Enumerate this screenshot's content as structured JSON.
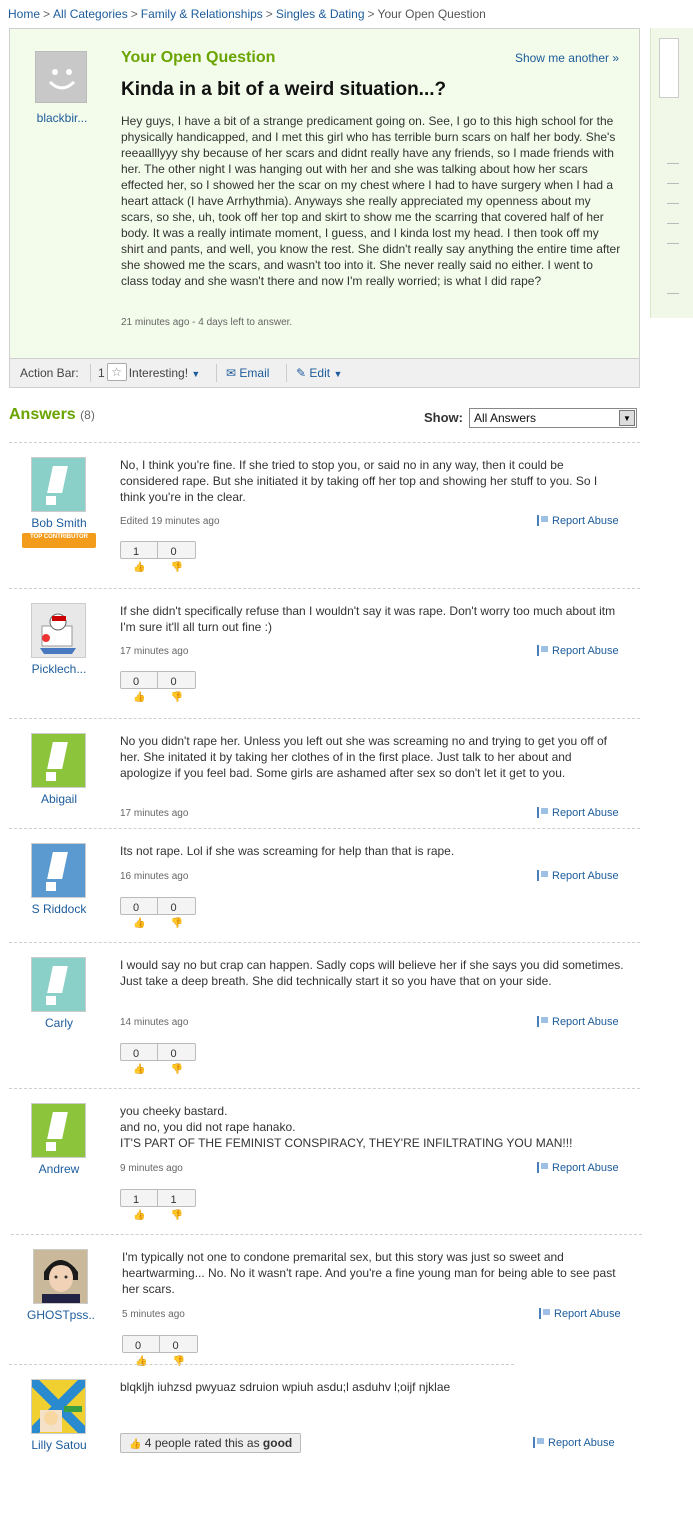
{
  "breadcrumb": {
    "items": [
      "Home",
      "All Categories",
      "Family & Relationships",
      "Singles & Dating"
    ],
    "current": "Your Open Question",
    "separator": ">"
  },
  "question": {
    "asker": "blackbir...",
    "heading": "Your Open Question",
    "show_another": "Show me another »",
    "title": "Kinda in a bit of a weird situation...?",
    "body": "Hey guys, I have a bit of a strange predicament going on. See, I go to this high school for the physically handicapped, and I met this girl who has terrible burn scars on half her body. She's reeaalllyyy shy because of her scars and didnt really have any friends, so I made friends with her. The other night I was hanging out with her and she was talking about how her scars effected her, so I showed her the scar on my chest where I had to have surgery when I had a heart attack (I have Arrhythmia). Anyways she really appreciated my openness about my scars, so she, uh, took off her top and skirt to show me the scarring that covered half of her body. It was a really intimate moment, I guess, and I kinda lost my head. I then took off my shirt and pants, and well, you know the rest. She didn't really say anything the entire time after she showed me the scars, and wasn't too into it. She never really said no either. I went to class today and she wasn't there and now I'm really worried; is what I did rape?",
    "meta": "21 minutes ago - 4 days left to answer."
  },
  "action_bar": {
    "label": "Action Bar:",
    "interesting_count": "1",
    "interesting_label": "Interesting!",
    "email_label": "Email",
    "edit_label": "Edit"
  },
  "answers_header": {
    "title": "Answers",
    "count": "(8)",
    "show_label": "Show:",
    "show_value": "All Answers"
  },
  "colors": {
    "green_heading": "#6aa400",
    "link_blue": "#1d5c9b",
    "question_bg": "#f3fbea",
    "badge_orange": "#f39c1c"
  },
  "answers": [
    {
      "user": "Bob Smith",
      "avatar_color": "#8ad0c8",
      "badge": "TOP CONTRIBUTOR",
      "text": "No, I think you're fine. If she tried to stop you, or said no in any way, then it could be considered rape. But she initiated it by taking off her top and showing her stuff to you. So I think you're in the clear.",
      "time": "Edited 19 minutes ago",
      "report": "Report Abuse",
      "up": "1",
      "down": "0"
    },
    {
      "user": "Picklech...",
      "avatar_color": "#e8e8e8",
      "text": "If she didn't specifically refuse than I wouldn't say it was rape. Don't worry too much about itm I'm sure it'll all turn out fine :)",
      "time": "17 minutes ago",
      "report": "Report Abuse",
      "up": "0",
      "down": "0"
    },
    {
      "user": "Abigail",
      "avatar_color": "#8cc43c",
      "text": "No you didn't rape her. Unless you left out she was screaming no and trying to get you off of her. She initated it by taking her clothes of in the first place. Just talk to her about and apologize if you feel bad. Some girls are ashamed after sex so don't let it get to you.",
      "time": "17 minutes ago",
      "report": "Report Abuse"
    },
    {
      "user": "S Riddock",
      "avatar_color": "#5a9ad0",
      "text": "Its not rape. Lol if she was screaming for help than that is rape.",
      "time": "16 minutes ago",
      "report": "Report Abuse",
      "up": "0",
      "down": "0"
    },
    {
      "user": "Carly",
      "avatar_color": "#8ad0c8",
      "text": "I would say no but crap can happen. Sadly cops will believe her if she says you did sometimes. Just take a deep breath. She did technically start it so you have that on your side.",
      "time": "14 minutes ago",
      "report": "Report Abuse",
      "up": "0",
      "down": "0"
    },
    {
      "user": "Andrew",
      "avatar_color": "#8cc43c",
      "text": "you cheeky bastard.\nand no, you did not rape hanako.\nIT'S PART OF THE FEMINIST CONSPIRACY, THEY'RE INFILTRATING YOU MAN!!!",
      "time": "9 minutes ago",
      "report": "Report Abuse",
      "up": "1",
      "down": "1"
    },
    {
      "user": "GHOSTpss..",
      "avatar_color": "#d8c8b0",
      "text": "I'm typically not one to condone premarital sex, but this story was just so sweet and heartwarming... No. No it wasn't rape. And you're a fine young man for being able to see past her scars.",
      "time": "5 minutes ago",
      "report": "Report Abuse",
      "up": "0",
      "down": "0"
    },
    {
      "user": "Lilly Satou",
      "avatar_color": "#3a9ad0",
      "text": "blqkljh iuhzsd pwyuaz sdruion wpiuh asdu;l asduhv l;oijf njklae",
      "rated_count": "4",
      "rated_prefix": "people rated this as",
      "rated_word": "good",
      "report": "Report Abuse"
    }
  ]
}
